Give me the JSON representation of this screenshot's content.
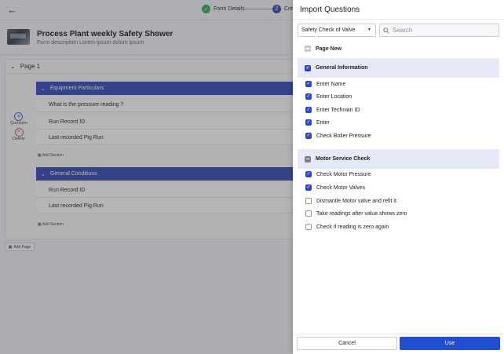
{
  "builder": {
    "steps": [
      {
        "label": "Form Details",
        "state": "done"
      },
      {
        "label": "Crea",
        "number": "2",
        "state": "active"
      }
    ],
    "form_title": "Process Plant weekly Safety Shower",
    "form_description": "Form description Lorem ipsum dolom ipsum",
    "page_label": "Page 1",
    "tools": {
      "question": "Question",
      "delete": "Delete"
    },
    "sections": [
      {
        "title": "Equipment Particulars",
        "questions": [
          "What is the pressure reading ?",
          "Run Record ID",
          "Last recorded Pig Run"
        ]
      },
      {
        "title": "General Conditions",
        "questions": [
          "Run Record ID",
          "Last recorded Pig Run"
        ]
      }
    ],
    "add_section_label": "Add Section",
    "add_page_label": "Add Page"
  },
  "panel": {
    "title": "Import Questions",
    "dropdown_value": "Safety Check of Valve",
    "search_placeholder": "Search",
    "page_row": "Page New",
    "groups": [
      {
        "title": "General Information",
        "items": [
          "Enter Name",
          "Enter Location",
          "Enter Technian ID",
          "Enter",
          "Check Boiler Pressure"
        ]
      },
      {
        "title": "Motor Service Check",
        "items": [
          "Check Motor Pressure",
          "Check Motor Valves",
          "Dismantle Motor valve and refit it",
          "Take readings after value shows zero",
          "Check if reading is zero again"
        ]
      }
    ],
    "cancel_label": "Cancel",
    "use_label": "Use",
    "accent_color": "#1f4fd0"
  }
}
